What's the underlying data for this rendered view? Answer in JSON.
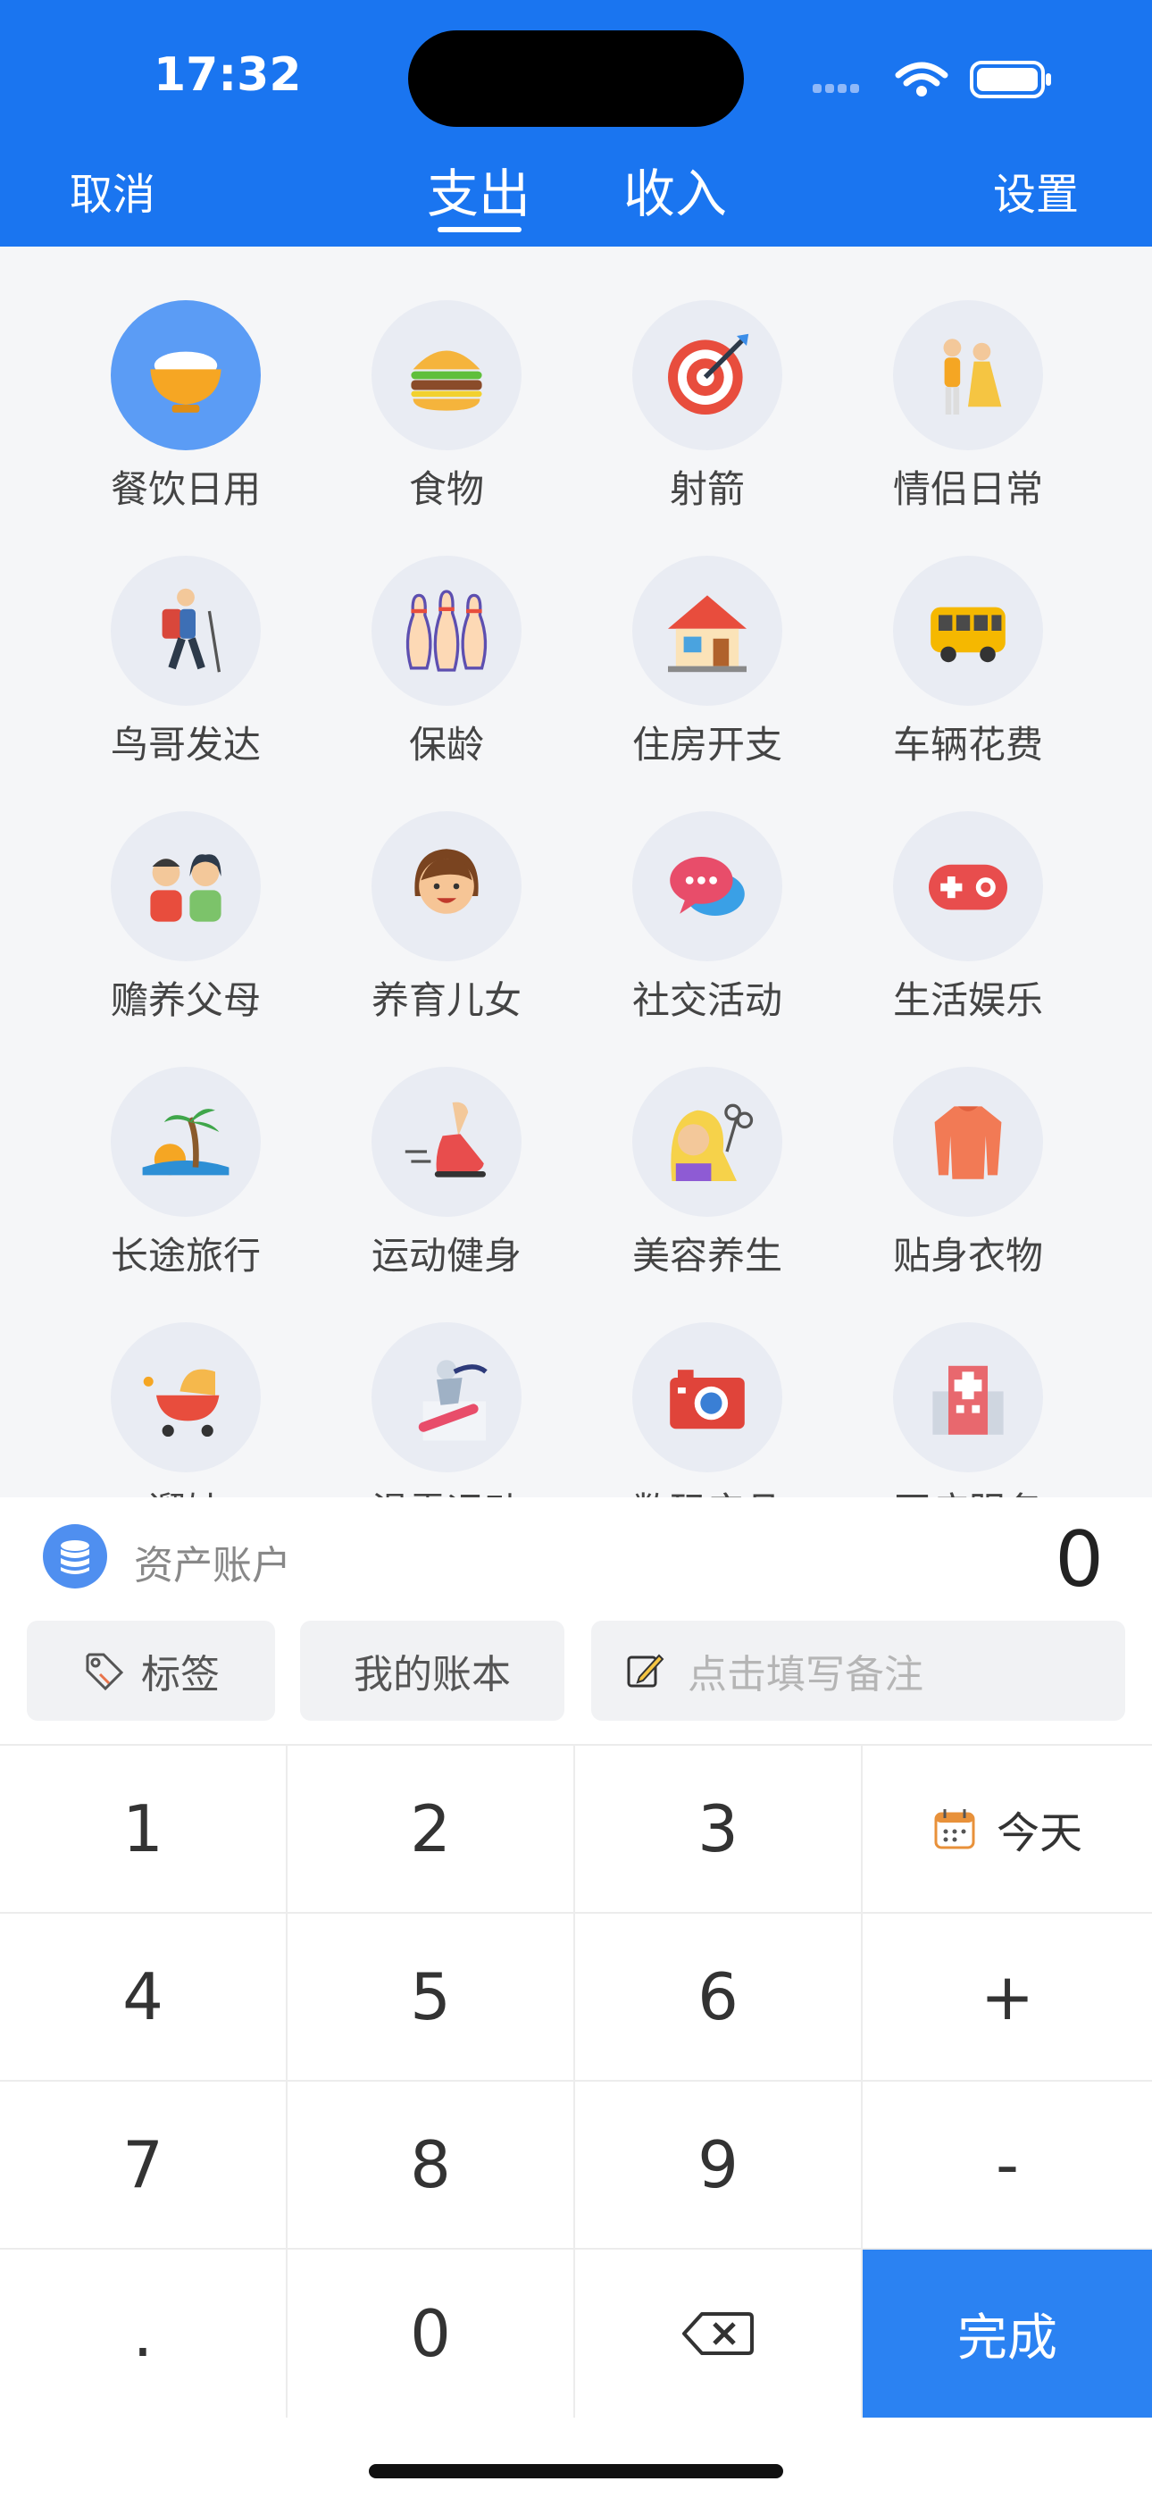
{
  "status_bar": {
    "time": "17:32"
  },
  "nav": {
    "cancel": "取消",
    "tabs": [
      "支出",
      "收入"
    ],
    "settings": "设置"
  },
  "categories": [
    {
      "label": "餐饮日用",
      "icon": "rice-bowl-icon",
      "selected": true
    },
    {
      "label": "食物",
      "icon": "burger-icon"
    },
    {
      "label": "射箭",
      "icon": "archery-target-icon"
    },
    {
      "label": "情侣日常",
      "icon": "couple-icon"
    },
    {
      "label": "鸟哥发达",
      "icon": "hiker-icon"
    },
    {
      "label": "保龄",
      "icon": "bowling-pins-icon"
    },
    {
      "label": "住房开支",
      "icon": "house-icon"
    },
    {
      "label": "车辆花费",
      "icon": "bus-icon"
    },
    {
      "label": "赡养父母",
      "icon": "parents-icon"
    },
    {
      "label": "养育儿女",
      "icon": "child-icon"
    },
    {
      "label": "社交活动",
      "icon": "chat-bubbles-icon"
    },
    {
      "label": "生活娱乐",
      "icon": "gamepad-icon"
    },
    {
      "label": "长途旅行",
      "icon": "palm-beach-icon"
    },
    {
      "label": "运动健身",
      "icon": "running-shoe-icon"
    },
    {
      "label": "美容养生",
      "icon": "hair-salon-icon"
    },
    {
      "label": "贴身衣物",
      "icon": "sweater-icon"
    },
    {
      "label": "遛娃",
      "icon": "stroller-icon"
    },
    {
      "label": "滑雪运动",
      "icon": "snowboard-icon"
    },
    {
      "label": "数码产品",
      "icon": "camera-icon"
    },
    {
      "label": "医疗服务",
      "icon": "hospital-icon"
    }
  ],
  "account": {
    "label": "资产账户",
    "amount": "0"
  },
  "chips": {
    "tag": "标签",
    "book": "我的账本",
    "note_placeholder": "点击填写备注"
  },
  "keypad": {
    "keys": [
      "1",
      "2",
      "3",
      "今天",
      "4",
      "5",
      "6",
      "+",
      "7",
      "8",
      "9",
      "-",
      ".",
      "0",
      "",
      "完成"
    ]
  },
  "colors": {
    "primary": "#1a75f0",
    "selected_circle": "#5b9cf5",
    "done_button": "#2b82f2"
  }
}
